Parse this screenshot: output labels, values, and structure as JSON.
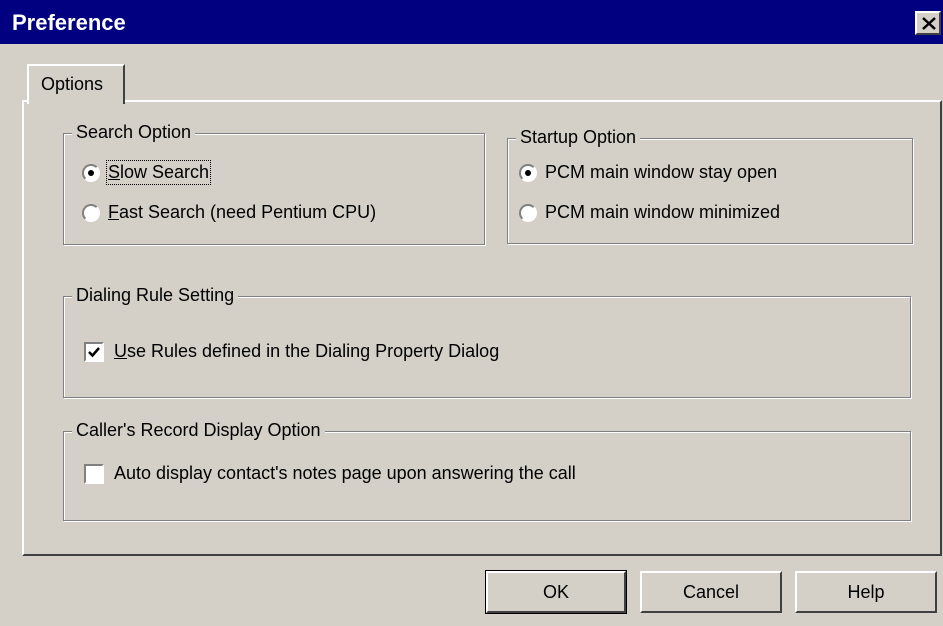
{
  "window": {
    "title": "Preference"
  },
  "tabs": [
    {
      "label": "Options"
    }
  ],
  "search_option": {
    "legend": "Search Option",
    "options": [
      {
        "label": "Slow Search",
        "selected": true
      },
      {
        "label": "Fast Search (need Pentium CPU)",
        "selected": false
      }
    ]
  },
  "startup_option": {
    "legend": "Startup Option",
    "options": [
      {
        "label": "PCM main window stay open",
        "selected": true
      },
      {
        "label": "PCM main window minimized",
        "selected": false
      }
    ]
  },
  "dialing_rule": {
    "legend": "Dialing Rule Setting",
    "checkbox": {
      "label": "Use Rules defined in the Dialing Property Dialog",
      "checked": true
    }
  },
  "caller_record": {
    "legend": "Caller's Record Display Option",
    "checkbox": {
      "label": "Auto display contact's notes page upon answering the call",
      "checked": false
    }
  },
  "buttons": {
    "ok": "OK",
    "cancel": "Cancel",
    "help": "Help"
  },
  "icons": {
    "close": "close-icon",
    "check": "checkmark-icon"
  }
}
